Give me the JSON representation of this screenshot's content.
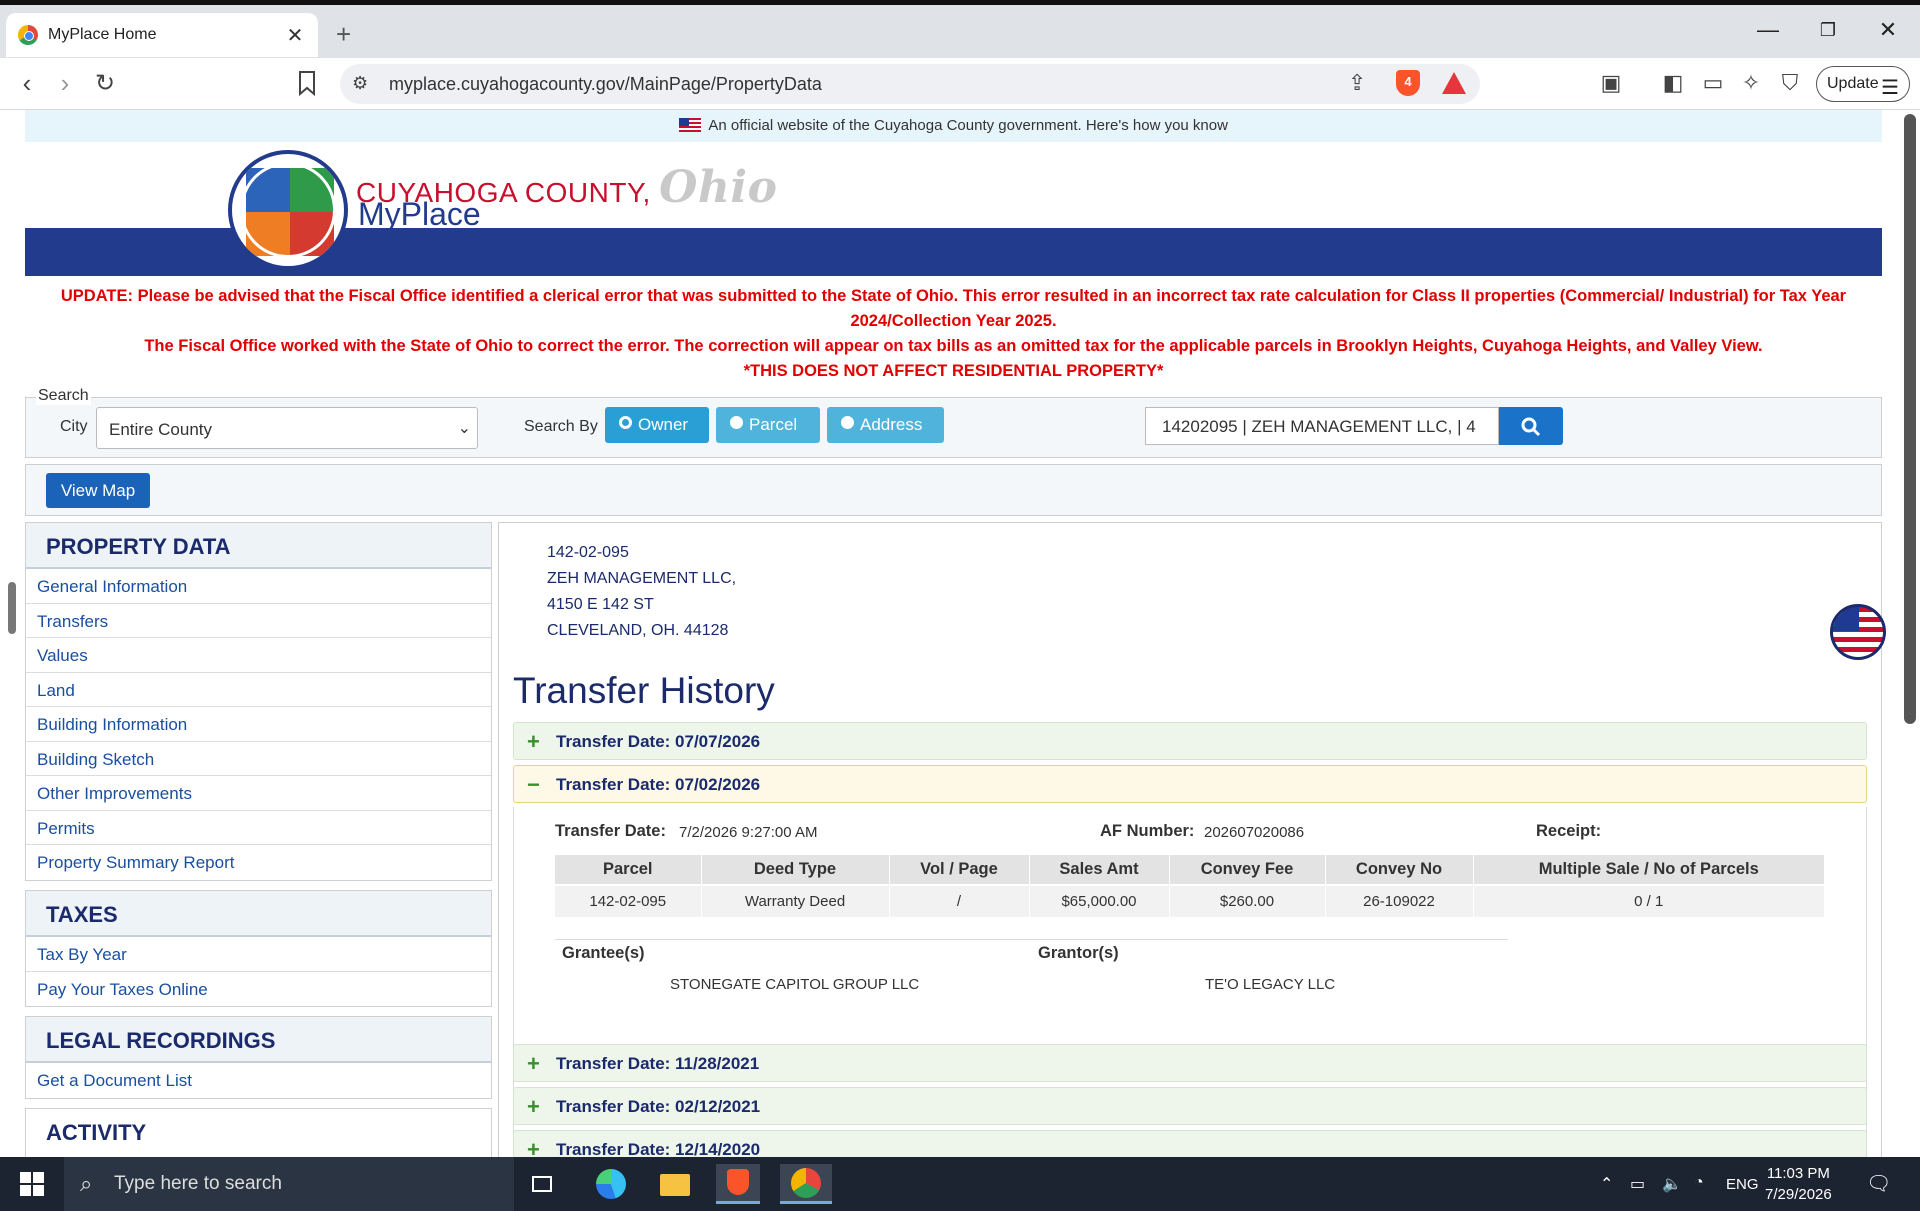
{
  "browser": {
    "tab_title": "MyPlace Home",
    "url": "myplace.cuyahogacounty.gov/MainPage/PropertyData",
    "update_label": "Update"
  },
  "site": {
    "official_notice": "An official website of the Cuyahoga County government. Here's how you know",
    "brand_county": "CUYAHOGA COUNTY,",
    "brand_state": "Ohio",
    "brand_app": "MyPlace",
    "alert_line1": "UPDATE: Please be advised that the Fiscal Office identified a clerical error that was submitted to the State of Ohio. This error resulted in an incorrect tax rate calculation for Class II properties (Commercial/ Industrial) for Tax Year 2024/Collection Year 2025.",
    "alert_line2": "The Fiscal Office worked with the State of Ohio to correct the error. The correction will appear on tax bills as an omitted tax for the applicable parcels in Brooklyn Heights, Cuyahoga Heights, and Valley View.",
    "alert_line3": "*THIS DOES NOT AFFECT RESIDENTIAL PROPERTY*"
  },
  "search": {
    "legend": "Search",
    "city_label": "City",
    "city_value": "Entire County",
    "search_by_label": "Search By",
    "options": [
      "Owner",
      "Parcel",
      "Address"
    ],
    "selected": "Owner",
    "query_value": "14202095 | ZEH MANAGEMENT LLC, | 4",
    "view_map_label": "View Map"
  },
  "sidebar": {
    "property_data": {
      "heading": "PROPERTY DATA",
      "items": [
        "General Information",
        "Transfers",
        "Values",
        "Land",
        "Building Information",
        "Building Sketch",
        "Other Improvements",
        "Permits",
        "Property Summary Report"
      ]
    },
    "taxes": {
      "heading": "TAXES",
      "items": [
        "Tax By Year",
        "Pay Your Taxes Online"
      ]
    },
    "legal": {
      "heading": "LEGAL RECORDINGS",
      "items": [
        "Get a Document List"
      ]
    },
    "activity": {
      "heading": "ACTIVITY"
    }
  },
  "property": {
    "parcel": "142-02-095",
    "owner": "ZEH MANAGEMENT LLC,",
    "address": "4150 E 142 ST",
    "city_line": "CLEVELAND, OH. 44128"
  },
  "history": {
    "title": "Transfer History",
    "transfers": [
      {
        "label": "Transfer Date: 07/07/2026",
        "sign": "+"
      },
      {
        "label": "Transfer Date: 07/02/2026",
        "sign": "−"
      },
      {
        "label": "Transfer Date: 11/28/2021",
        "sign": "+"
      },
      {
        "label": "Transfer Date: 02/12/2021",
        "sign": "+"
      },
      {
        "label": "Transfer Date: 12/14/2020",
        "sign": "+"
      }
    ],
    "detail": {
      "transfer_date_label": "Transfer Date:",
      "transfer_date_value": "7/2/2026 9:27:00 AM",
      "af_label": "AF Number:",
      "af_value": "202607020086",
      "receipt_label": "Receipt:",
      "columns": [
        "Parcel",
        "Deed Type",
        "Vol / Page",
        "Sales Amt",
        "Convey Fee",
        "Convey No",
        "Multiple Sale / No of Parcels"
      ],
      "row": [
        "142-02-095",
        "Warranty Deed",
        "/",
        "$65,000.00",
        "$260.00",
        "26-109022",
        "0 / 1"
      ],
      "grantee_label": "Grantee(s)",
      "grantee_value": "STONEGATE CAPITOL GROUP LLC",
      "grantor_label": "Grantor(s)",
      "grantor_value": "TE'O LEGACY LLC"
    }
  },
  "taskbar": {
    "search_placeholder": "Type here to search",
    "lang": "ENG",
    "time": "11:03 PM",
    "date": "7/29/2026"
  }
}
